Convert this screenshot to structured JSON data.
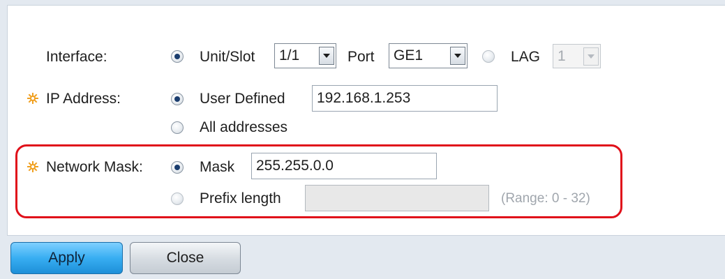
{
  "form": {
    "interface": {
      "label": "Interface:",
      "unit_slot_label": "Unit/Slot",
      "unit_slot_value": "1/1",
      "port_label": "Port",
      "port_value": "GE1",
      "lag_label": "LAG",
      "lag_value": "1",
      "selected": "unit_slot"
    },
    "ip_address": {
      "label": "IP Address:",
      "user_defined_label": "User Defined",
      "user_defined_value": "192.168.1.253",
      "all_addresses_label": "All addresses",
      "selected": "user_defined"
    },
    "network_mask": {
      "label": "Network Mask:",
      "mask_label": "Mask",
      "mask_value": "255.255.0.0",
      "prefix_label": "Prefix length",
      "prefix_value": "",
      "range_text": "(Range: 0 - 32)",
      "selected": "mask"
    }
  },
  "buttons": {
    "apply": "Apply",
    "close": "Close"
  },
  "colors": {
    "required_star": "#f0a020",
    "highlight_border": "#e0101a",
    "apply_button": "#38aef2",
    "radio_dot": "#1b3d6e"
  }
}
